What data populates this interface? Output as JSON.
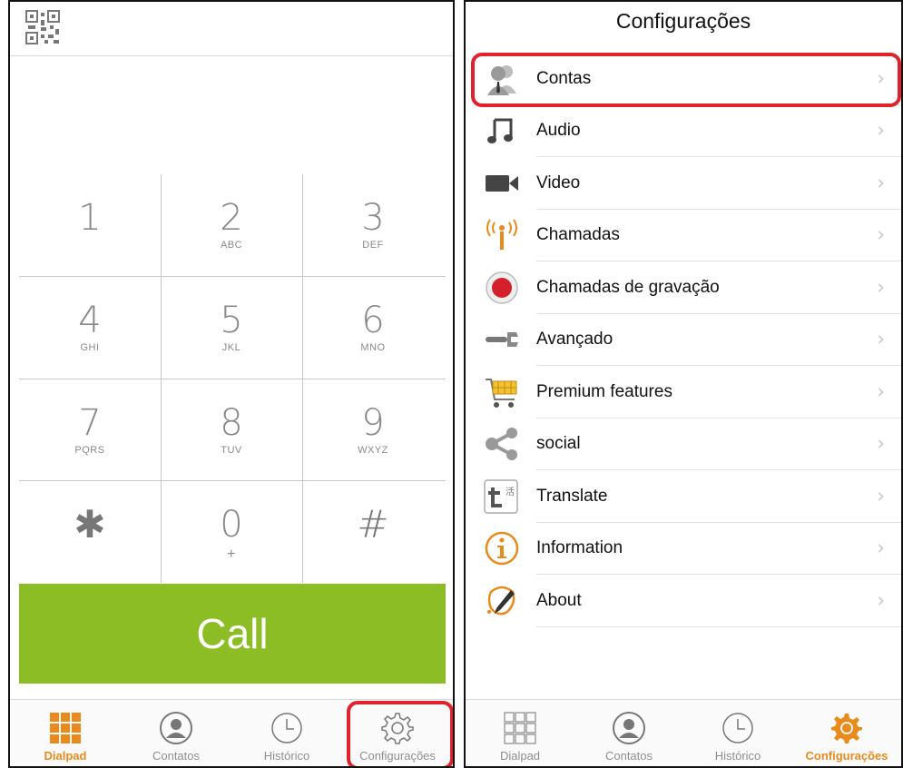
{
  "dialpad_screen": {
    "keys": [
      {
        "digit": "1",
        "letters": ""
      },
      {
        "digit": "2",
        "letters": "ABC"
      },
      {
        "digit": "3",
        "letters": "DEF"
      },
      {
        "digit": "4",
        "letters": "GHI"
      },
      {
        "digit": "5",
        "letters": "JKL"
      },
      {
        "digit": "6",
        "letters": "MNO"
      },
      {
        "digit": "7",
        "letters": "PQRS"
      },
      {
        "digit": "8",
        "letters": "TUV"
      },
      {
        "digit": "9",
        "letters": "WXYZ"
      },
      {
        "digit": "✱",
        "letters": ""
      },
      {
        "digit": "0",
        "letters": "+"
      },
      {
        "digit": "#",
        "letters": ""
      }
    ],
    "call_label": "Call",
    "tabs": [
      {
        "label": "Dialpad",
        "icon": "dialpad-icon",
        "active": true
      },
      {
        "label": "Contatos",
        "icon": "contacts-icon",
        "active": false
      },
      {
        "label": "Histórico",
        "icon": "history-icon",
        "active": false
      },
      {
        "label": "Configurações",
        "icon": "settings-gear-icon",
        "active": false
      }
    ]
  },
  "settings_screen": {
    "title": "Configurações",
    "items": [
      {
        "label": "Contas",
        "icon": "accounts-icon"
      },
      {
        "label": "Audio",
        "icon": "music-note-icon"
      },
      {
        "label": "Video",
        "icon": "video-camera-icon"
      },
      {
        "label": "Chamadas",
        "icon": "antenna-icon"
      },
      {
        "label": "Chamadas de gravação",
        "icon": "record-icon"
      },
      {
        "label": "Avançado",
        "icon": "wrench-icon"
      },
      {
        "label": "Premium features",
        "icon": "shopping-cart-icon"
      },
      {
        "label": "social",
        "icon": "share-icon"
      },
      {
        "label": "Translate",
        "icon": "translate-icon"
      },
      {
        "label": "Information",
        "icon": "info-icon"
      },
      {
        "label": "About",
        "icon": "about-icon"
      }
    ],
    "chevron": "›",
    "tabs": [
      {
        "label": "Dialpad",
        "icon": "dialpad-icon",
        "active": false
      },
      {
        "label": "Contatos",
        "icon": "contacts-icon",
        "active": false
      },
      {
        "label": "Histórico",
        "icon": "history-icon",
        "active": false
      },
      {
        "label": "Configurações",
        "icon": "settings-gear-icon",
        "active": true
      }
    ]
  },
  "colors": {
    "accent_orange": "#e98a1d",
    "call_green": "#8dbd24",
    "highlight_red": "#e0212e"
  }
}
